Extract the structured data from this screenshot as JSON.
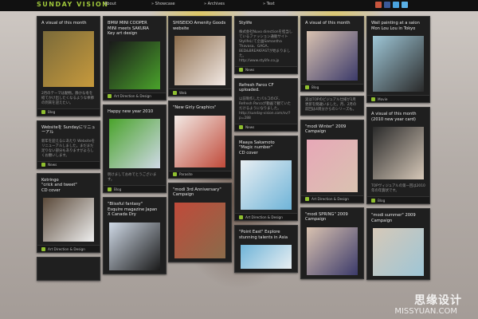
{
  "site": {
    "logo": "SUNDAY VISION",
    "nav": [
      "About",
      "» Showcase",
      "» Archives",
      "» Text"
    ],
    "icon_colors": [
      "#c8553d",
      "#3b5998",
      "#4aa3df",
      "#5ab0e6"
    ]
  },
  "columns": [
    [
      {
        "title": "A visual of this month",
        "text": "2月のテーマは動物。静かな冬を経てかけ出したくなるような季節の到来を迎えたい。",
        "tag": "Blog",
        "thumb_h": 70
      },
      {
        "title": "Websiteを Sundayにリニューアル",
        "text": "新年を迎えるにあたり Websiteをリニューアルしました。まだまだ足りない部分もありますがよろしくお願いします。",
        "tag": "News"
      },
      {
        "title": "Kotringo\n\"crick and tweet\"\nCD cover",
        "text": "",
        "tag": "Art Direction & Design",
        "thumb_h": 55
      },
      {
        "title": "",
        "text": "",
        "tag": ""
      }
    ],
    [
      {
        "title": "BMW MINI COOPER\nMINI meets SAKURA\nKey art design",
        "text": "",
        "tag": "Art Direction & Design",
        "thumb_h": 60
      },
      {
        "title": "Happy new year 2010",
        "text": "明けましておめでとうございます。",
        "tag": "Blog",
        "thumb_h": 62
      },
      {
        "title": "\"Blissful fantasy\"\nEsquire magazine Japan\nX Canada Dry",
        "text": "",
        "tag": "",
        "thumb_h": 60
      }
    ],
    [
      {
        "title": "SHISEIDO Amenity Goods\nwebsite",
        "text": "",
        "tag": "Web",
        "thumb_h": 62
      },
      {
        "title": "\"New Girly Graphics\"",
        "text": "",
        "tag": "Parasite",
        "thumb_h": 65
      },
      {
        "title": "\"modi 3rd Anniversary\"\nCampaign",
        "text": "",
        "tag": "",
        "thumb_h": 70
      }
    ],
    [
      {
        "title": "Stylife",
        "text": "株式会社Nuvo directionを担当しているファッション通販サイトStylifeにて企画Samantha Thavasa、GAGA、BED&BREAKFASTが始まりました。\nhttp://www.stylife.co.jp",
        "tag": "News"
      },
      {
        "title": "Refresh Parco CF\nuploaded.",
        "text": "以前制作したパルコのCF、Refresh Parcoが動画で観ていただけるようになりました。\nhttp://sunday-vision.com/sv/?p=288",
        "tag": "News"
      },
      {
        "title": "Maaya Sakamoto\n\"Magic number\"\nCD cover",
        "text": "",
        "tag": "Art Direction & Design",
        "thumb_h": 62
      },
      {
        "title": "\"Point East\" Explore\nstunning talents in Asia",
        "text": "",
        "tag": "",
        "thumb_h": 30
      }
    ],
    [
      {
        "title": "A visual of this month",
        "text": "",
        "tag": "Blog",
        "thumb_h": 62
      },
      {
        "title": "",
        "text": "実はTOPのビジュアル仕様が1月更新を間違いました。月、2月の前回は4周分からのシリーズも。",
        "tag": ""
      },
      {
        "title": "\"modi Winter\" 2009\nCampaign",
        "text": "",
        "tag": "Art Direction & Design",
        "thumb_h": 66
      },
      {
        "title": "\"modi SPRING\" 2009\nCampaign",
        "text": "",
        "tag": "",
        "thumb_h": 60
      }
    ],
    [
      {
        "title": "Wall painting at a salon\nMon Lou Lou in Tokyo",
        "text": "",
        "tag": "Movie",
        "thumb_h": 70
      },
      {
        "title": "A visual of this month\n(2010 new year card)",
        "text": "TOPヴィジュアルの第一回は2010年の年賀状です。",
        "tag": "Blog",
        "thumb_h": 66
      },
      {
        "title": "\"modi summer\" 2009\nCampaign",
        "text": "",
        "tag": "",
        "thumb_h": 60
      }
    ]
  ],
  "watermark": {
    "main": "思缘设计",
    "sub": "MISSYUAN.COM"
  }
}
